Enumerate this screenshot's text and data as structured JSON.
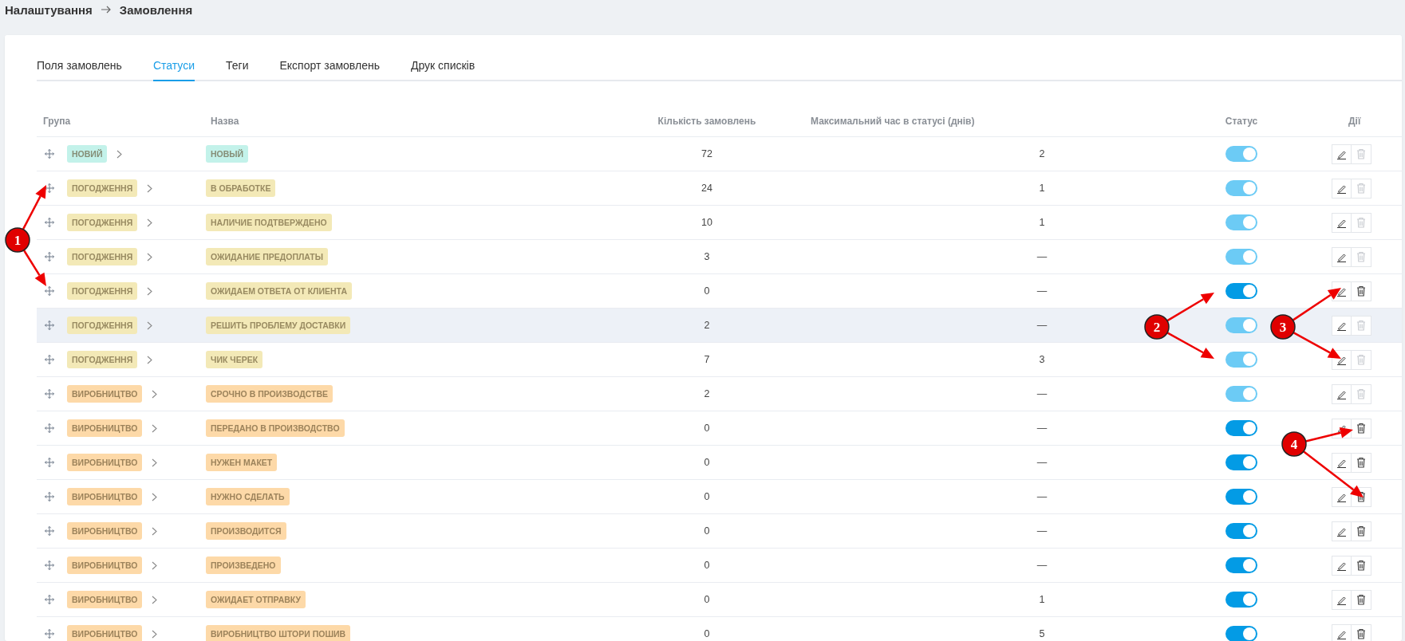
{
  "breadcrumb": {
    "parent": "Налаштування",
    "current": "Замовлення"
  },
  "tabs": [
    {
      "label": "Поля замовлень",
      "selected": false
    },
    {
      "label": "Статуси",
      "selected": true
    },
    {
      "label": "Теги",
      "selected": false
    },
    {
      "label": "Експорт замовлень",
      "selected": false
    },
    {
      "label": "Друк списків",
      "selected": false
    }
  ],
  "table": {
    "columns": [
      "Група",
      "Назва",
      "Кількість замовлень",
      "Максимальний час в статусі (днів)",
      "Статус",
      "Дії"
    ],
    "rows": [
      {
        "group": "НОВИЙ",
        "color": "#c3f2ea",
        "name": "НОВЫЙ",
        "count": "72",
        "max_days": "2",
        "on": true,
        "disabled": true,
        "highlighted": false
      },
      {
        "group": "ПОГОДЖЕННЯ",
        "color": "#f3e9b7",
        "name": "В ОБРАБОТКЕ",
        "count": "24",
        "max_days": "1",
        "on": true,
        "disabled": true,
        "highlighted": false
      },
      {
        "group": "ПОГОДЖЕННЯ",
        "color": "#f3e9b7",
        "name": "НАЛИЧИЕ ПОДТВЕРЖДЕНО",
        "count": "10",
        "max_days": "1",
        "on": true,
        "disabled": true,
        "highlighted": false
      },
      {
        "group": "ПОГОДЖЕННЯ",
        "color": "#f3e9b7",
        "name": "ОЖИДАНИЕ ПРЕДОПЛАТЫ",
        "count": "3",
        "max_days": "—",
        "on": true,
        "disabled": true,
        "highlighted": false
      },
      {
        "group": "ПОГОДЖЕННЯ",
        "color": "#f3e9b7",
        "name": "ОЖИДАЕМ ОТВЕТА ОТ КЛИЕНТА",
        "count": "0",
        "max_days": "—",
        "on": true,
        "disabled": false,
        "highlighted": false
      },
      {
        "group": "ПОГОДЖЕННЯ",
        "color": "#f3e9b7",
        "name": "РЕШИТЬ ПРОБЛЕМУ ДОСТАВКИ",
        "count": "2",
        "max_days": "—",
        "on": true,
        "disabled": true,
        "highlighted": true
      },
      {
        "group": "ПОГОДЖЕННЯ",
        "color": "#f3e9b7",
        "name": "ЧИК ЧЕРЕК",
        "count": "7",
        "max_days": "3",
        "on": true,
        "disabled": true,
        "highlighted": false
      },
      {
        "group": "ВИРОБНИЦТВО",
        "color": "#fdd9a8",
        "name": "СРОЧНО В ПРОИЗВОДСТВЕ",
        "count": "2",
        "max_days": "—",
        "on": true,
        "disabled": true,
        "highlighted": false
      },
      {
        "group": "ВИРОБНИЦТВО",
        "color": "#fdd9a8",
        "name": "ПЕРЕДАНО В ПРОИЗВОДСТВО",
        "count": "0",
        "max_days": "—",
        "on": true,
        "disabled": false,
        "highlighted": false
      },
      {
        "group": "ВИРОБНИЦТВО",
        "color": "#fdd9a8",
        "name": "НУЖЕН МАКЕТ",
        "count": "0",
        "max_days": "—",
        "on": true,
        "disabled": false,
        "highlighted": false
      },
      {
        "group": "ВИРОБНИЦТВО",
        "color": "#fdd9a8",
        "name": "НУЖНО СДЕЛАТЬ",
        "count": "0",
        "max_days": "—",
        "on": true,
        "disabled": false,
        "highlighted": false
      },
      {
        "group": "ВИРОБНИЦТВО",
        "color": "#fdd9a8",
        "name": "ПРОИЗВОДИТСЯ",
        "count": "0",
        "max_days": "—",
        "on": true,
        "disabled": false,
        "highlighted": false
      },
      {
        "group": "ВИРОБНИЦТВО",
        "color": "#fdd9a8",
        "name": "ПРОИЗВЕДЕНО",
        "count": "0",
        "max_days": "—",
        "on": true,
        "disabled": false,
        "highlighted": false
      },
      {
        "group": "ВИРОБНИЦТВО",
        "color": "#fdd9a8",
        "name": "ОЖИДАЕТ ОТПРАВКУ",
        "count": "0",
        "max_days": "1",
        "on": true,
        "disabled": false,
        "highlighted": false
      },
      {
        "group": "ВИРОБНИЦТВО",
        "color": "#fdd9a8",
        "name": "ВИРОБНИЦТВО ШТОРИ ПОШИВ",
        "count": "0",
        "max_days": "5",
        "on": true,
        "disabled": false,
        "highlighted": false
      }
    ]
  },
  "annotations": [
    {
      "label": "1"
    },
    {
      "label": "2"
    },
    {
      "label": "3"
    },
    {
      "label": "4"
    }
  ]
}
